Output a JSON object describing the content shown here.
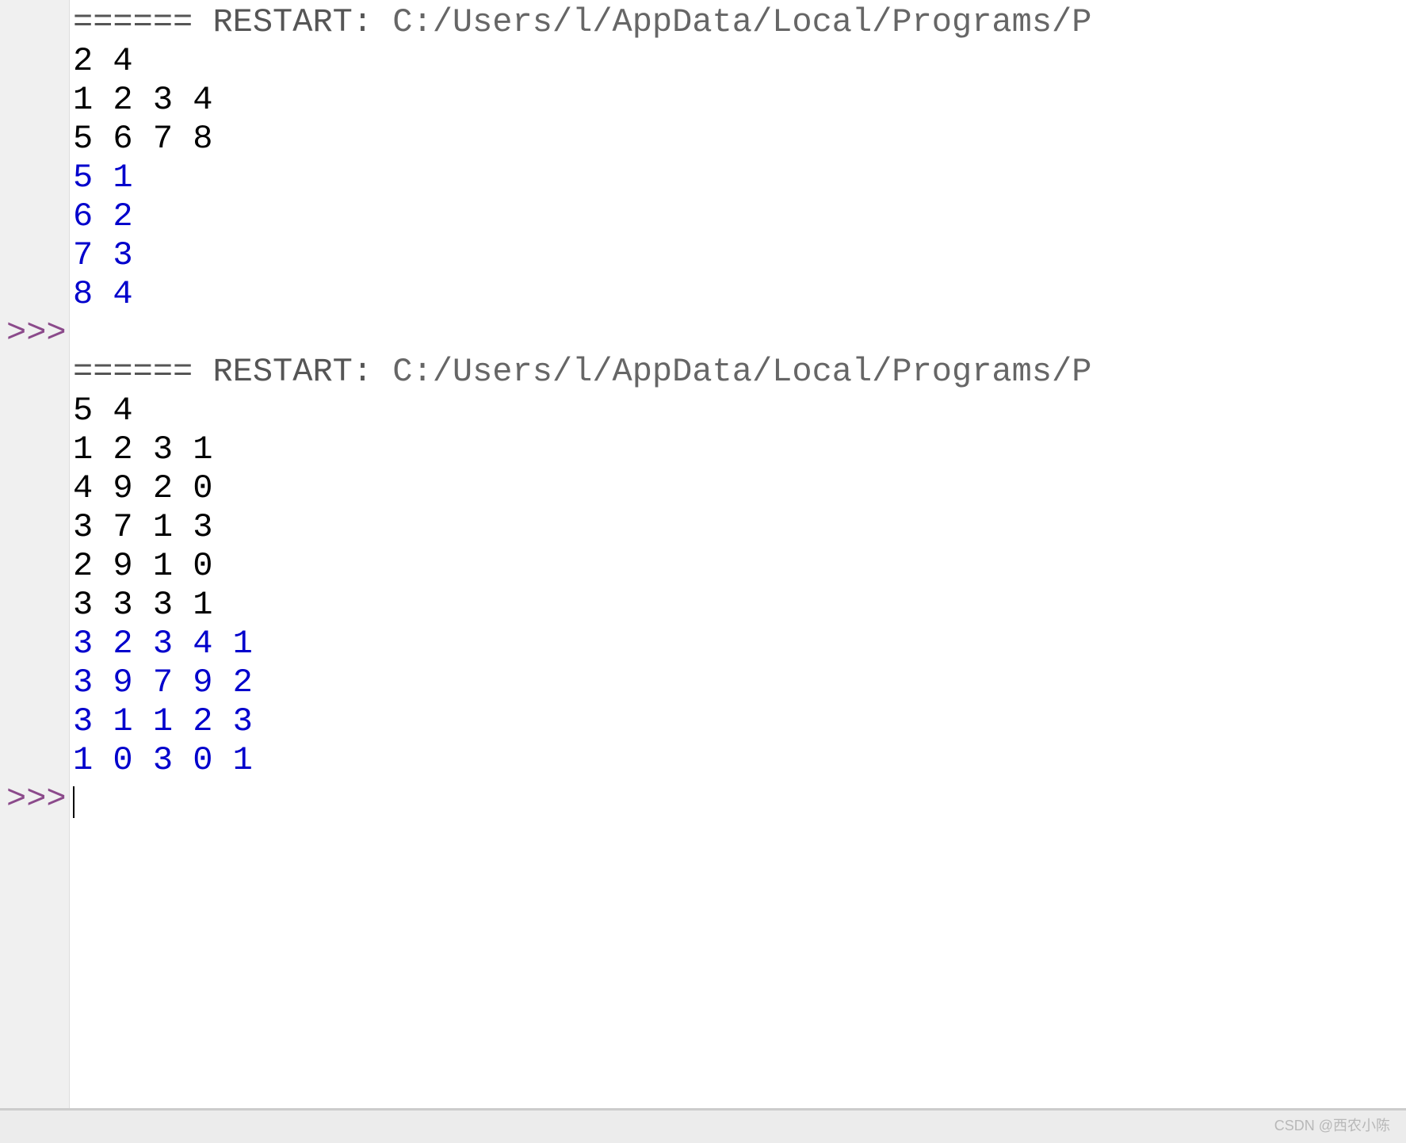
{
  "shell": {
    "prompt_symbol": ">>>",
    "session1": {
      "restart_prefix": "======",
      "restart_label": " RESTART: ",
      "restart_path": "C:/Users/l/AppData/Local/Programs/P",
      "input_lines": [
        "2 4",
        "1 2 3 4",
        "5 6 7 8"
      ],
      "output_lines": [
        "5 1",
        "6 2",
        "7 3",
        "8 4"
      ]
    },
    "session2": {
      "restart_prefix": "======",
      "restart_label": " RESTART: ",
      "restart_path": "C:/Users/l/AppData/Local/Programs/P",
      "input_lines": [
        "5 4",
        "1 2 3 1",
        "4 9 2 0",
        "3 7 1 3",
        "2 9 1 0",
        "3 3 3 1"
      ],
      "output_lines": [
        "3 2 3 4 1",
        "3 9 7 9 2",
        "3 1 1 2 3",
        "1 0 3 0 1"
      ]
    }
  },
  "watermark": "CSDN @西农小陈"
}
